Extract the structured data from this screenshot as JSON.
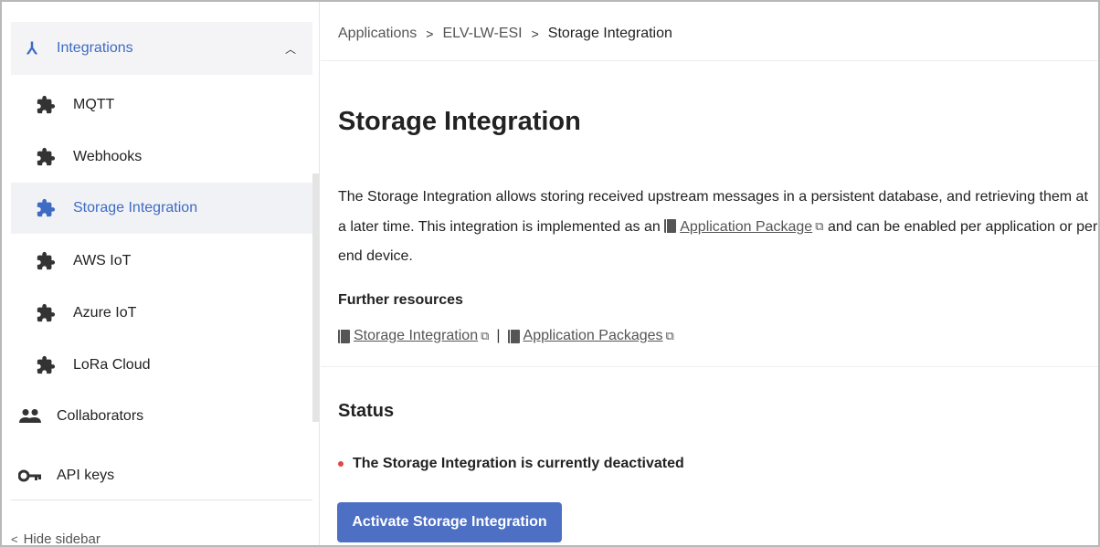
{
  "sidebar": {
    "group": {
      "label": "Integrations",
      "icon": "integrations-icon",
      "chevron": "^"
    },
    "sub_items": [
      {
        "label": "MQTT",
        "icon": "puzzle-icon"
      },
      {
        "label": "Webhooks",
        "icon": "puzzle-icon"
      },
      {
        "label": "Storage Integration",
        "icon": "puzzle-icon",
        "active": true
      },
      {
        "label": "AWS IoT",
        "icon": "puzzle-icon"
      },
      {
        "label": "Azure IoT",
        "icon": "puzzle-icon"
      },
      {
        "label": "LoRa Cloud",
        "icon": "puzzle-icon"
      }
    ],
    "items": [
      {
        "label": "Collaborators",
        "icon": "users-icon"
      },
      {
        "label": "API keys",
        "icon": "key-icon"
      }
    ],
    "hide_label": "Hide sidebar"
  },
  "breadcrumb": {
    "items": [
      "Applications",
      "ELV-LW-ESI",
      "Storage Integration"
    ]
  },
  "page": {
    "title": "Storage Integration",
    "description_1": "The Storage Integration allows storing received upstream messages in a persistent database, and retrieving them at a later time. This integration is implemented as an",
    "description_link": "Application Package",
    "description_2": "and can be enabled per application or per end device.",
    "resources_title": "Further resources",
    "resources": [
      "Storage Integration",
      "Application Packages"
    ],
    "resources_sep": "|",
    "status_title": "Status",
    "status_text": "The Storage Integration is currently deactivated",
    "activate_button": "Activate Storage Integration"
  },
  "colors": {
    "accent": "#3e6bc4",
    "button": "#4d6fc4",
    "status_inactive": "#e04848"
  }
}
